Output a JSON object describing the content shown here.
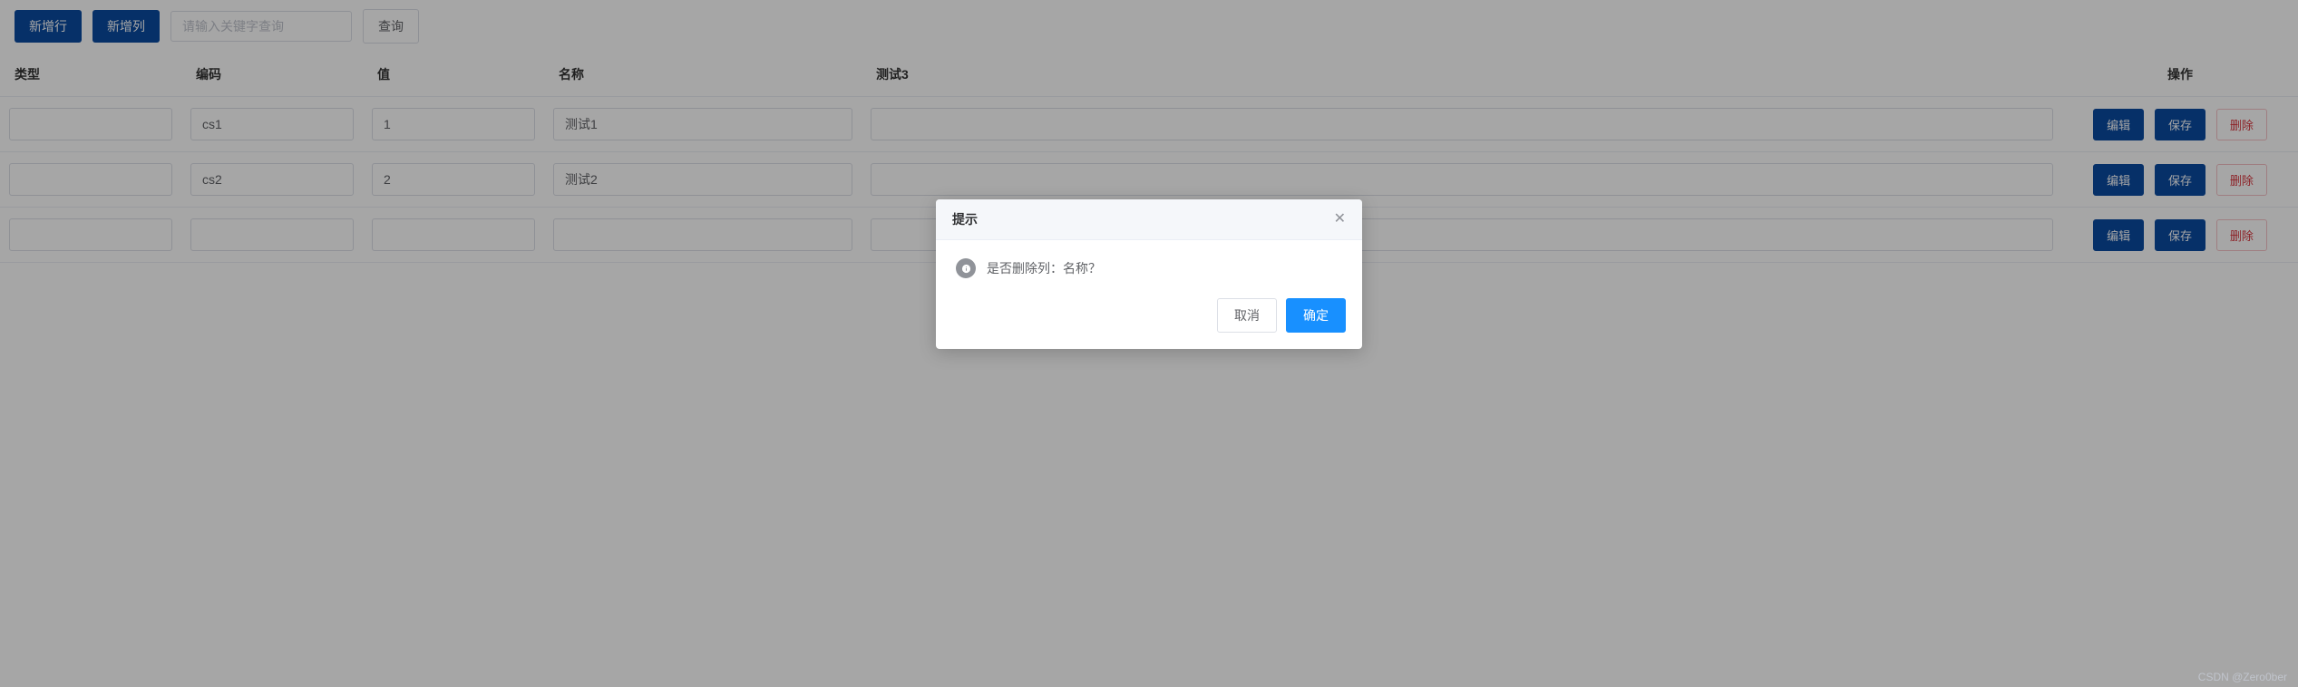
{
  "toolbar": {
    "add_row_label": "新增行",
    "add_col_label": "新增列",
    "search_placeholder": "请输入关键字查询",
    "search_label": "查询"
  },
  "table": {
    "headers": {
      "type": "类型",
      "code": "编码",
      "value": "值",
      "name": "名称",
      "test3": "测试3",
      "op": "操作"
    },
    "rows": [
      {
        "type": "",
        "code": "cs1",
        "value": "1",
        "name": "测试1",
        "test3": ""
      },
      {
        "type": "",
        "code": "cs2",
        "value": "2",
        "name": "测试2",
        "test3": ""
      },
      {
        "type": "",
        "code": "",
        "value": "",
        "name": "",
        "test3": ""
      }
    ],
    "actions": {
      "edit": "编辑",
      "save": "保存",
      "delete": "删除"
    }
  },
  "modal": {
    "title": "提示",
    "message": "是否删除列：名称？",
    "cancel": "取消",
    "confirm": "确定"
  },
  "watermark": "CSDN @Zero0ber"
}
